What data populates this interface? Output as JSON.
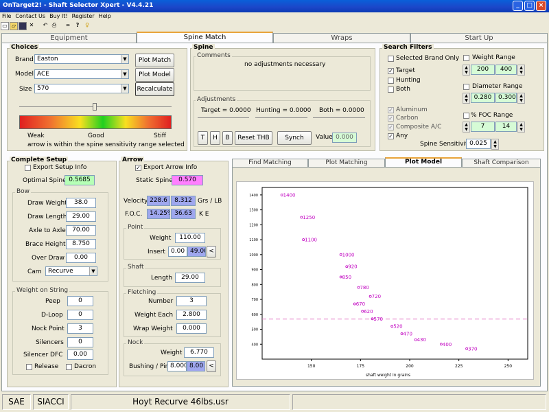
{
  "window": {
    "title": "OnTarget2! - Shaft Selector Xpert - V4.4.21",
    "buttons": [
      "_",
      "□",
      "×"
    ]
  },
  "menu": [
    "File",
    "Contact Us",
    "Buy It!",
    "Register",
    "Help"
  ],
  "toolbar_icons": [
    "new-icon",
    "open-icon",
    "save-icon",
    "delete-icon",
    "undo-icon",
    "print-icon",
    "binoculars-icon",
    "help-icon",
    "info-icon"
  ],
  "tabs": [
    "Equipment",
    "Spine Match",
    "Wraps",
    "Start Up"
  ],
  "choices": {
    "title": "Choices",
    "brand_label": "Brand",
    "brand_value": "Easton",
    "model_label": "Model",
    "model_value": "ACE",
    "size_label": "Size",
    "size_value": "570",
    "plot_match": "Plot Match",
    "plot_model": "Plot Model",
    "recalculate": "Recalculate",
    "scale_labels": [
      "Weak",
      "Good",
      "Stiff"
    ],
    "message": "arrow is within the spine sensitivity range selected"
  },
  "spine": {
    "title": "Spine",
    "comments_title": "Comments",
    "comment": "no adjustments necessary",
    "adjustments_title": "Adjustments",
    "target": "Target = 0.0000",
    "hunting": "Hunting = 0.0000",
    "both": "Both = 0.0000",
    "buttons": [
      "T",
      "H",
      "B",
      "Reset THB",
      "Synch"
    ],
    "value_label": "Value",
    "value": "0.000"
  },
  "search_filters": {
    "title": "Search Filters",
    "selected_brand_only": "Selected Brand Only",
    "target": "Target",
    "hunting": "Hunting",
    "both": "Both",
    "aluminum": "Aluminum",
    "carbon": "Carbon",
    "composite": "Composite A/C",
    "any": "Any",
    "weight_range": "Weight Range",
    "weight_min": "200",
    "weight_max": "400",
    "diameter_range": "Diameter Range",
    "diameter_min": "0.280",
    "diameter_max": "0.300",
    "foc_range": "% FOC Range",
    "foc_min": "7",
    "foc_max": "14",
    "spine_sensitivity_label": "Spine Sensitivity",
    "spine_sensitivity": "0.025"
  },
  "complete_setup": {
    "title": "Complete Setup",
    "export": "Export Setup Info",
    "optimal_spine_label": "Optimal Spine",
    "optimal_spine": "0.5685",
    "bow_title": "Bow",
    "draw_weight_label": "Draw Weight",
    "draw_weight": "38.0",
    "draw_length_label": "Draw Length",
    "draw_length": "29.00",
    "axle_label": "Axle to Axle",
    "axle": "70.00",
    "brace_label": "Brace Height",
    "brace": "8.750",
    "overdraw_label": "Over Draw",
    "overdraw": "0.00",
    "cam_label": "Cam",
    "cam": "Recurve",
    "wos_title": "Weight on String",
    "peep_label": "Peep",
    "peep": "0",
    "dloop_label": "D-Loop",
    "dloop": "0",
    "nock_point_label": "Nock Point",
    "nock_point": "3",
    "silencers_label": "Silencers",
    "silencers": "0",
    "silencer_dfc_label": "Silencer DFC",
    "silencer_dfc": "0.00",
    "release": "Release",
    "dacron": "Dacron"
  },
  "arrow": {
    "title": "Arrow",
    "export": "Export Arrow Info",
    "static_spine_label": "Static Spine",
    "static_spine": "0.570",
    "velocity_label": "Velocity",
    "velocity": "228.6",
    "grs_lb": "8.312",
    "grs_lb_label": "Grs / LB",
    "foc_label": "F.O.C.",
    "foc": "14.25%",
    "ke": "36.63",
    "ke_label": "K E",
    "point_title": "Point",
    "point_weight_label": "Weight",
    "point_weight": "110.00",
    "insert_label": "Insert",
    "insert": "0.00",
    "insert_total": "49.00",
    "shaft_title": "Shaft",
    "length_label": "Length",
    "length": "29.00",
    "fletching_title": "Fletching",
    "number_label": "Number",
    "number": "3",
    "weight_each_label": "Weight Each",
    "weight_each": "2.800",
    "wrap_weight_label": "Wrap Weight",
    "wrap_weight": "0.000",
    "nock_title": "Nock",
    "nock_weight_label": "Weight",
    "nock_weight": "6.770",
    "bushing_label": "Bushing / Pin",
    "bushing": "8.000",
    "bushing_total": "8.00",
    "arrow_btn": "<"
  },
  "chart_tabs": [
    "Find Matching",
    "Plot Matching",
    "Plot Model",
    "Shaft Comparison"
  ],
  "chart_data": {
    "type": "scatter",
    "xlabel": "shaft weight in grains",
    "ylabel": "",
    "xlim": [
      125,
      260
    ],
    "ylim": [
      300,
      1450
    ],
    "xticks": [
      150,
      175,
      200,
      225,
      250
    ],
    "yticks": [
      400,
      500,
      600,
      700,
      800,
      900,
      1000,
      1100,
      1200,
      1300,
      1400
    ],
    "reference_line": 568.5,
    "points": [
      {
        "label": "1400",
        "x": 135,
        "y": 1400
      },
      {
        "label": "1250",
        "x": 145,
        "y": 1250
      },
      {
        "label": "1100",
        "x": 146,
        "y": 1100
      },
      {
        "label": "1000",
        "x": 165,
        "y": 1000
      },
      {
        "label": "920",
        "x": 168,
        "y": 920
      },
      {
        "label": "850",
        "x": 165,
        "y": 850
      },
      {
        "label": "780",
        "x": 174,
        "y": 780
      },
      {
        "label": "720",
        "x": 180,
        "y": 720
      },
      {
        "label": "670",
        "x": 172,
        "y": 670
      },
      {
        "label": "620",
        "x": 176,
        "y": 620
      },
      {
        "label": "570",
        "x": 181,
        "y": 570
      },
      {
        "label": "520",
        "x": 191,
        "y": 520
      },
      {
        "label": "470",
        "x": 196,
        "y": 470
      },
      {
        "label": "430",
        "x": 203,
        "y": 430
      },
      {
        "label": "400",
        "x": 216,
        "y": 400
      },
      {
        "label": "370",
        "x": 229,
        "y": 370
      }
    ],
    "point_color": "#c000c0"
  },
  "status": {
    "units": "SAE",
    "formula": "SIACCI",
    "file": "Hoyt Recurve 46lbs.usr"
  }
}
